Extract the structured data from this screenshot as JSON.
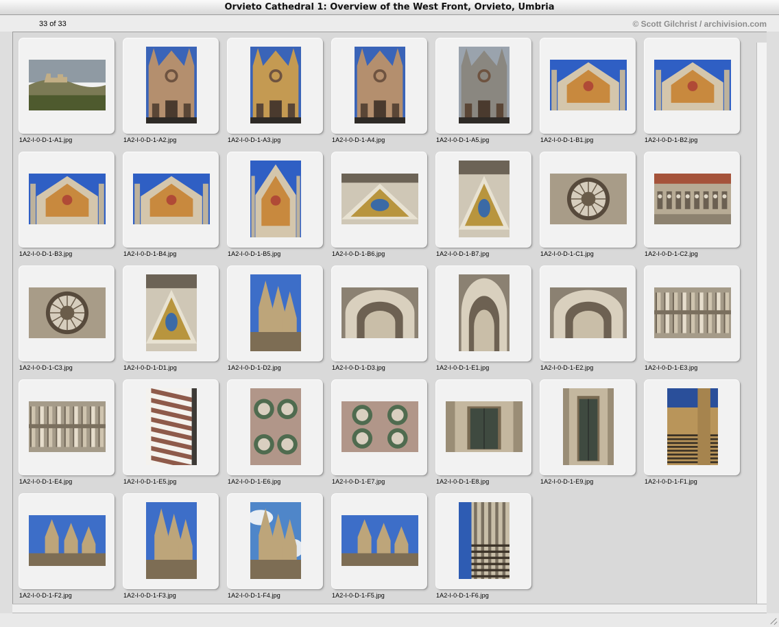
{
  "window": {
    "title": "Orvieto Cathedral 1: Overview of the West Front, Orvieto, Umbria"
  },
  "header": {
    "count": "33 of 33",
    "credit": "© Scott Gilchrist / archivision.com"
  },
  "thumbnails": [
    {
      "file": "1A2-I-0-D-1-A1.jpg",
      "orient": "landscape",
      "scene": "town"
    },
    {
      "file": "1A2-I-0-D-1-A2.jpg",
      "orient": "portrait",
      "scene": "facade"
    },
    {
      "file": "1A2-I-0-D-1-A3.jpg",
      "orient": "portrait",
      "scene": "facade-gold"
    },
    {
      "file": "1A2-I-0-D-1-A4.jpg",
      "orient": "portrait",
      "scene": "facade"
    },
    {
      "file": "1A2-I-0-D-1-A5.jpg",
      "orient": "portrait",
      "scene": "facade-gray"
    },
    {
      "file": "1A2-I-0-D-1-B1.jpg",
      "orient": "landscape",
      "scene": "gable"
    },
    {
      "file": "1A2-I-0-D-1-B2.jpg",
      "orient": "landscape",
      "scene": "gable"
    },
    {
      "file": "1A2-I-0-D-1-B3.jpg",
      "orient": "landscape",
      "scene": "gable"
    },
    {
      "file": "1A2-I-0-D-1-B4.jpg",
      "orient": "landscape",
      "scene": "gable"
    },
    {
      "file": "1A2-I-0-D-1-B5.jpg",
      "orient": "portrait",
      "scene": "gable"
    },
    {
      "file": "1A2-I-0-D-1-B6.jpg",
      "orient": "landscape",
      "scene": "mosaic"
    },
    {
      "file": "1A2-I-0-D-1-B7.jpg",
      "orient": "portrait",
      "scene": "mosaic"
    },
    {
      "file": "1A2-I-0-D-1-C1.jpg",
      "orient": "landscape",
      "scene": "rose"
    },
    {
      "file": "1A2-I-0-D-1-C2.jpg",
      "orient": "landscape",
      "scene": "niches"
    },
    {
      "file": "1A2-I-0-D-1-C3.jpg",
      "orient": "landscape",
      "scene": "rose"
    },
    {
      "file": "1A2-I-0-D-1-D1.jpg",
      "orient": "portrait",
      "scene": "mosaic"
    },
    {
      "file": "1A2-I-0-D-1-D2.jpg",
      "orient": "portrait",
      "scene": "spire-sky"
    },
    {
      "file": "1A2-I-0-D-1-D3.jpg",
      "orient": "landscape",
      "scene": "arch"
    },
    {
      "file": "1A2-I-0-D-1-E1.jpg",
      "orient": "portrait",
      "scene": "arch"
    },
    {
      "file": "1A2-I-0-D-1-E2.jpg",
      "orient": "landscape",
      "scene": "arch"
    },
    {
      "file": "1A2-I-0-D-1-E3.jpg",
      "orient": "landscape",
      "scene": "columns"
    },
    {
      "file": "1A2-I-0-D-1-E4.jpg",
      "orient": "landscape",
      "scene": "columns"
    },
    {
      "file": "1A2-I-0-D-1-E5.jpg",
      "orient": "portrait",
      "scene": "spiral"
    },
    {
      "file": "1A2-I-0-D-1-E6.jpg",
      "orient": "portrait",
      "scene": "tracery"
    },
    {
      "file": "1A2-I-0-D-1-E7.jpg",
      "orient": "landscape",
      "scene": "tracery"
    },
    {
      "file": "1A2-I-0-D-1-E8.jpg",
      "orient": "landscape",
      "scene": "door"
    },
    {
      "file": "1A2-I-0-D-1-E9.jpg",
      "orient": "portrait",
      "scene": "door"
    },
    {
      "file": "1A2-I-0-D-1-F1.jpg",
      "orient": "portrait",
      "scene": "stripes"
    },
    {
      "file": "1A2-I-0-D-1-F2.jpg",
      "orient": "landscape",
      "scene": "spire-sky"
    },
    {
      "file": "1A2-I-0-D-1-F3.jpg",
      "orient": "portrait",
      "scene": "spire-sky"
    },
    {
      "file": "1A2-I-0-D-1-F4.jpg",
      "orient": "portrait",
      "scene": "spire-cloud"
    },
    {
      "file": "1A2-I-0-D-1-F5.jpg",
      "orient": "landscape",
      "scene": "spire-sky"
    },
    {
      "file": "1A2-I-0-D-1-F6.jpg",
      "orient": "portrait",
      "scene": "column-stripe"
    }
  ]
}
